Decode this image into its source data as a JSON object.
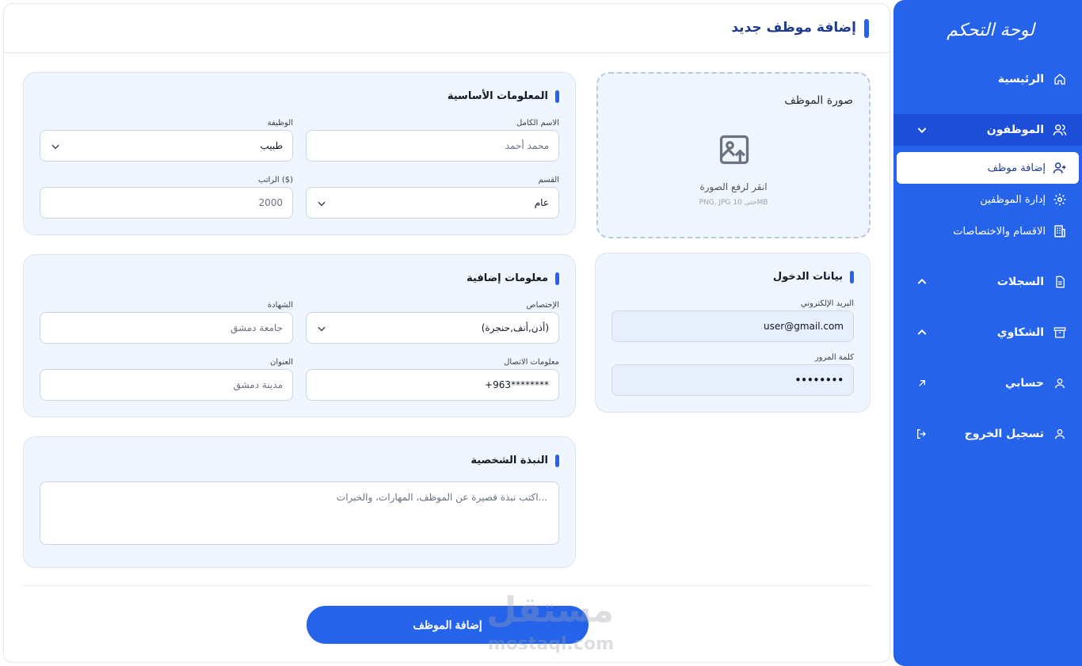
{
  "sidebar": {
    "title": "لوحة التحكم",
    "items": {
      "home": "الرئيسية",
      "employees": "الموظفون",
      "records": "السجلات",
      "complaints": "الشكاوي",
      "account": "حسابي",
      "logout": "تسجيل الخروج"
    },
    "sub_items": {
      "add_employee": "إضافة موظف",
      "manage_employees": "إدارة الموظفين",
      "departments": "الاقسام والاختصاصات"
    }
  },
  "header": {
    "title": "إضافة موظف جديد"
  },
  "basic_info": {
    "title": "المعلومات الأساسية",
    "full_name_label": "الاسم الكامل",
    "full_name_placeholder": "محمد أحمد",
    "job_label": "الوظيفة",
    "job_value": "طبيب",
    "department_label": "القسم",
    "department_value": "عام",
    "salary_label": "الراتب ($)",
    "salary_value": "2000"
  },
  "extra_info": {
    "title": "معلومات إضافية",
    "specialty_label": "الإختصاص",
    "specialty_value": "(أذن,أنف,حنجرة)",
    "degree_label": "الشهادة",
    "degree_placeholder": "جامعة دمشق",
    "contact_label": "معلومات الاتصال",
    "contact_placeholder": "+963********",
    "address_label": "العنوان",
    "address_placeholder": "مدينة دمشق"
  },
  "bio": {
    "title": "النبذة الشخصية",
    "placeholder": "اكتب نبذة قصيرة عن الموظف، المهارات، والخبرات..."
  },
  "photo": {
    "title": "صورة الموظف",
    "hint": "انقر لرفع الصورة",
    "sub": "PNG, JPG حتى 10MB"
  },
  "login": {
    "title": "بيانات الدخول",
    "email_label": "البريد الإلكتروني",
    "email_value": "user@gmail.com",
    "password_label": "كلمة المرور",
    "password_value": "••••••••"
  },
  "submit_label": "إضافة الموظف",
  "watermark": {
    "main": "مستقل",
    "sub": "mostaql.com"
  },
  "colors": {
    "primary": "#2563eb",
    "panel": "#eff6ff",
    "title": "#1e3a8a"
  }
}
